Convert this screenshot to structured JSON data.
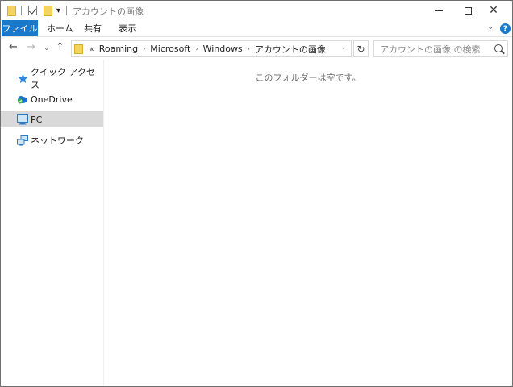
{
  "window": {
    "title": "アカウントの画像"
  },
  "quick_access_toolbar": {
    "customize_glyph": "▾"
  },
  "ribbon": {
    "tabs": [
      "ファイル",
      "ホーム",
      "共有",
      "表示"
    ],
    "help_glyph": "?",
    "expand_glyph": "⌄"
  },
  "navigation": {
    "back_glyph": "←",
    "forward_glyph": "→",
    "recent_glyph": "⌄",
    "up_glyph": "↑"
  },
  "address_bar": {
    "overflow": "«",
    "crumbs": [
      "Roaming",
      "Microsoft",
      "Windows",
      "アカウントの画像"
    ],
    "separator": "›",
    "dropdown_glyph": "⌄",
    "refresh_glyph": "↻"
  },
  "search": {
    "placeholder": "アカウントの画像 の検索"
  },
  "nav_pane": {
    "items": [
      {
        "label": "クイック アクセス",
        "icon": "star-icon"
      },
      {
        "label": "OneDrive",
        "icon": "onedrive-cloud-icon"
      },
      {
        "label": "PC",
        "icon": "monitor-icon",
        "selected": true
      },
      {
        "label": "ネットワーク",
        "icon": "network-icon"
      }
    ]
  },
  "content": {
    "empty_message": "このフォルダーは空です。"
  },
  "colors": {
    "file_tab_bg": "#1979ca",
    "selection_bg": "#d9d9d9",
    "folder_yellow": "#f4d35e"
  }
}
